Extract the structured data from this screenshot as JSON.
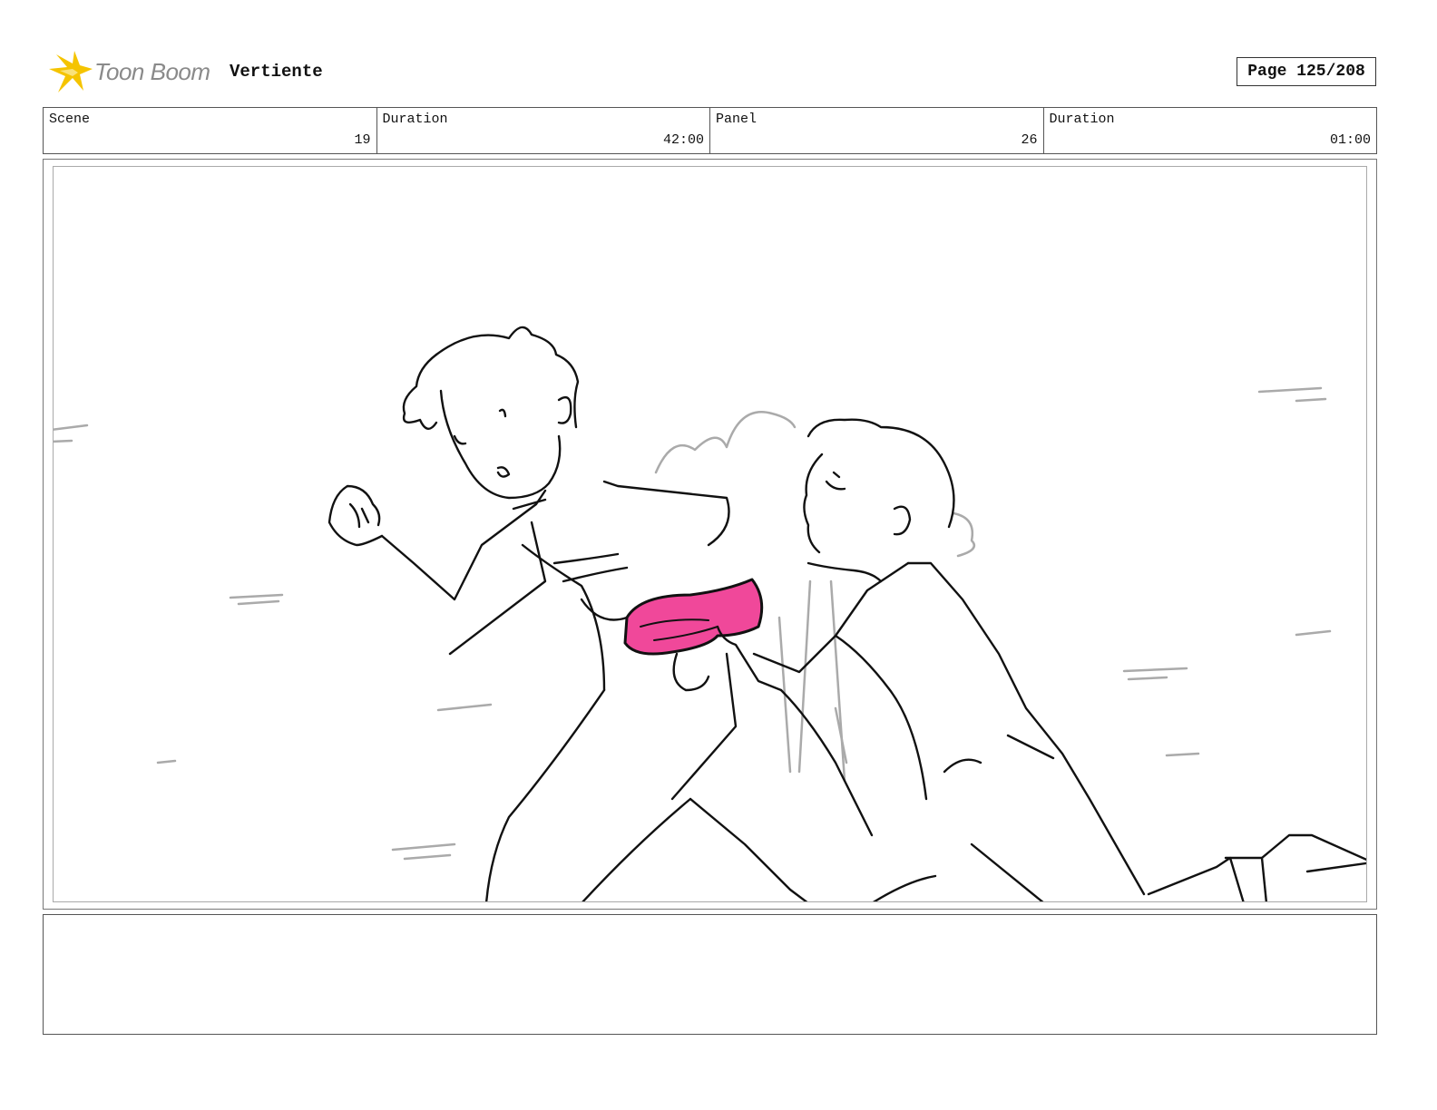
{
  "header": {
    "logo_text": "Toon Boom",
    "project_title": "Vertiente",
    "page_label": "Page 125/208"
  },
  "info": [
    {
      "label": "Scene",
      "value": "19"
    },
    {
      "label": "Duration",
      "value": "42:00"
    },
    {
      "label": "Panel",
      "value": "26"
    },
    {
      "label": "Duration",
      "value": "01:00"
    }
  ],
  "panel": {
    "accent_color": "#f0489a",
    "line_color": "#111111",
    "guide_color": "#aaaaaa"
  },
  "notes": ""
}
